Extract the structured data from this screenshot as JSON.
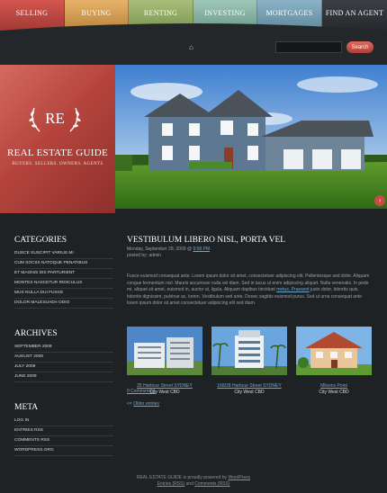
{
  "nav": {
    "items": [
      {
        "label": "SELLING",
        "color": "#c44a44"
      },
      {
        "label": "BUYING",
        "color": "#d9a25a"
      },
      {
        "label": "RENTING",
        "color": "#95ad67"
      },
      {
        "label": "INVESTING",
        "color": "#86b4a5"
      },
      {
        "label": "MORTGAGES",
        "color": "#76a0b4"
      },
      {
        "label": "FIND AN AGENT",
        "color": "#2e3236"
      }
    ]
  },
  "search": {
    "placeholder": "",
    "button_label": "Search"
  },
  "brand": {
    "monogram": "RE",
    "title": "REAL ESTATE GUIDE",
    "tagline": "BUYERS. SELLERS. OWNERS. AGENTS"
  },
  "sidebar": {
    "categories": {
      "heading": "CATEGORIES",
      "items": [
        "DUSCE SUSCIPIT VARIUS MI",
        "CUM SOCIIS NATOQUE PENATIBUS",
        "ET MAGNIS DIS PARTURIENT",
        "MONTES NASCETUR RIDICULUS",
        "MUS NULLA DUI FUSCE",
        "DOLOR MALESUADA ODIO"
      ]
    },
    "archives": {
      "heading": "ARCHIVES",
      "items": [
        "SEPTEMBER 2009",
        "AUGUST 2009",
        "JULY 2009",
        "JUNE 2009"
      ]
    },
    "meta": {
      "heading": "META",
      "items": [
        "LOG IN",
        "ENTRIES RSS",
        "COMMENTS RSS",
        "WORDPRESS.ORG"
      ]
    }
  },
  "post": {
    "title": "VESTIBULUM LIBERO NISL, PORTA VEL",
    "date_prefix": "Monday, September 28, 2009 @",
    "date_link": "9:58 PM",
    "author": "posted by: admin",
    "body_1": "Fusce euismod consequat ante. Lorem ipsum dolor sit amet, consectetuer adipiscing elit. Pellentesque sed dolor. Aliquam congue fermentum nisl. Mauris accumsan nulla vel diam. Sed in lacus ut enim adipiscing aliquet. Nulla venenatis. In pede mi, aliquet sit amet, euismod in, auctor ut, ligula. Aliquam dapibus tincidunt",
    "body_link": "metus. Praesent",
    "body_2": "justo dolor, lobortis quis, lobortis dignissim, pulvinar ac, lorem. Vestibulum sed ante. Donec sagittis euismod purus. Sed ut urna consequat ante lorem ipsum dolor sit amet consectetuer adipiscing elit sed diam.",
    "listings": [
      {
        "name": "25 Harbour Street SYDNEY",
        "location": "City West CBD"
      },
      {
        "name": "168/28 Harbour Street SYDNEY",
        "location": "City West CBD"
      },
      {
        "name": "Milsons Point",
        "location": "City West CBD"
      }
    ],
    "comments": "0 Comment(s)",
    "older_prefix": "<<",
    "older_link": "Older entries"
  },
  "footer": {
    "line1_site": "REAL ESTATE GUIDE",
    "line1_text": "is proudly powered by",
    "line1_link": "WordPress",
    "line2_entries": "Entries (RSS)",
    "line2_and": "and",
    "line2_comments": "Comments (RSS)"
  }
}
